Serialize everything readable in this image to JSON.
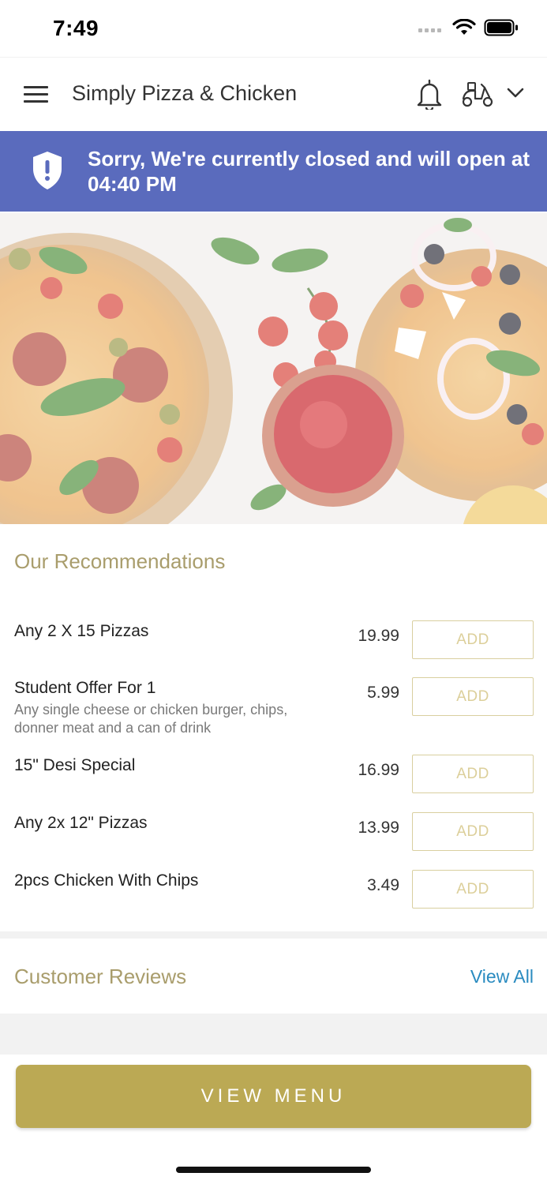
{
  "status_bar": {
    "time": "7:49"
  },
  "header": {
    "store_name": "Simply Pizza & Chicken",
    "icons": [
      "hamburger-menu-icon",
      "bell-icon",
      "scooter-delivery-icon",
      "chevron-down-icon"
    ]
  },
  "banner": {
    "message": "Sorry, We're currently closed and will open at 04:40 PM",
    "icon": "shield-alert-icon",
    "background": "#5a6bbd"
  },
  "recommendations": {
    "title": "Our Recommendations",
    "items": [
      {
        "name": "Any 2 X 15 Pizzas",
        "description": "",
        "price": "19.99",
        "button": "ADD"
      },
      {
        "name": "Student Offer For 1",
        "description": "Any single cheese or chicken burger, chips, donner meat and a can of drink",
        "price": "5.99",
        "button": "ADD"
      },
      {
        "name": "15\" Desi Special",
        "description": "",
        "price": "16.99",
        "button": "ADD"
      },
      {
        "name": "Any 2x 12\" Pizzas",
        "description": "",
        "price": "13.99",
        "button": "ADD"
      },
      {
        "name": "2pcs Chicken With Chips",
        "description": "",
        "price": "3.49",
        "button": "ADD"
      }
    ]
  },
  "reviews": {
    "title": "Customer Reviews",
    "view_all": "View All"
  },
  "footer": {
    "view_menu": "VIEW MENU"
  },
  "colors": {
    "accent": "#bba954",
    "link": "#2a8bc0",
    "section_title": "#a99d6c"
  }
}
